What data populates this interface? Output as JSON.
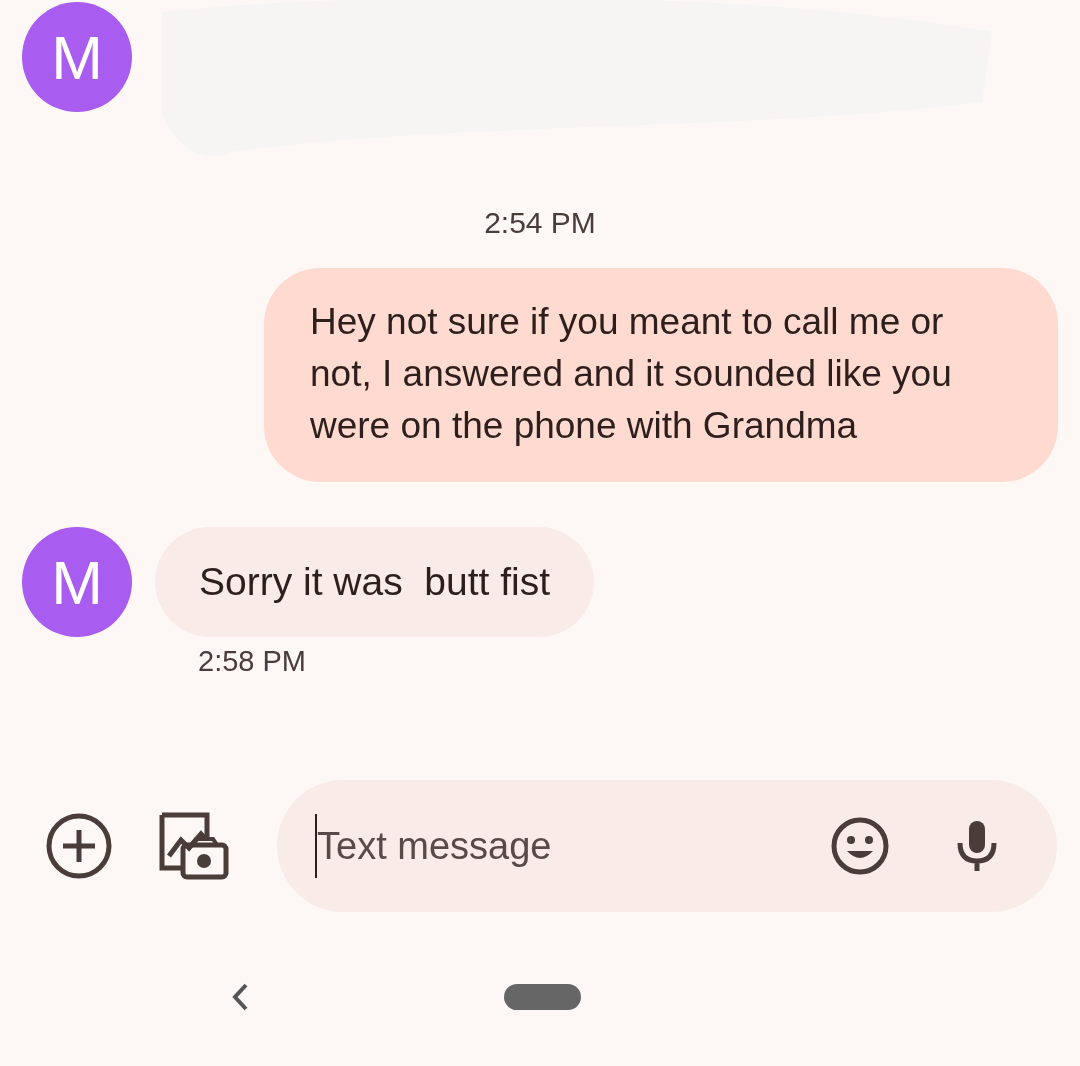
{
  "conversation": [
    {
      "kind": "redacted",
      "avatar": "M"
    },
    {
      "kind": "timestamp",
      "text": "2:54 PM"
    },
    {
      "kind": "outgoing",
      "text": "Hey not sure if you meant to call me or not, I answered and it sounded like you were on the phone with Grandma"
    },
    {
      "kind": "incoming",
      "avatar": "M",
      "text": "Sorry it was  butt fist",
      "time": "2:58 PM"
    }
  ],
  "composer": {
    "placeholder": "Text message"
  }
}
